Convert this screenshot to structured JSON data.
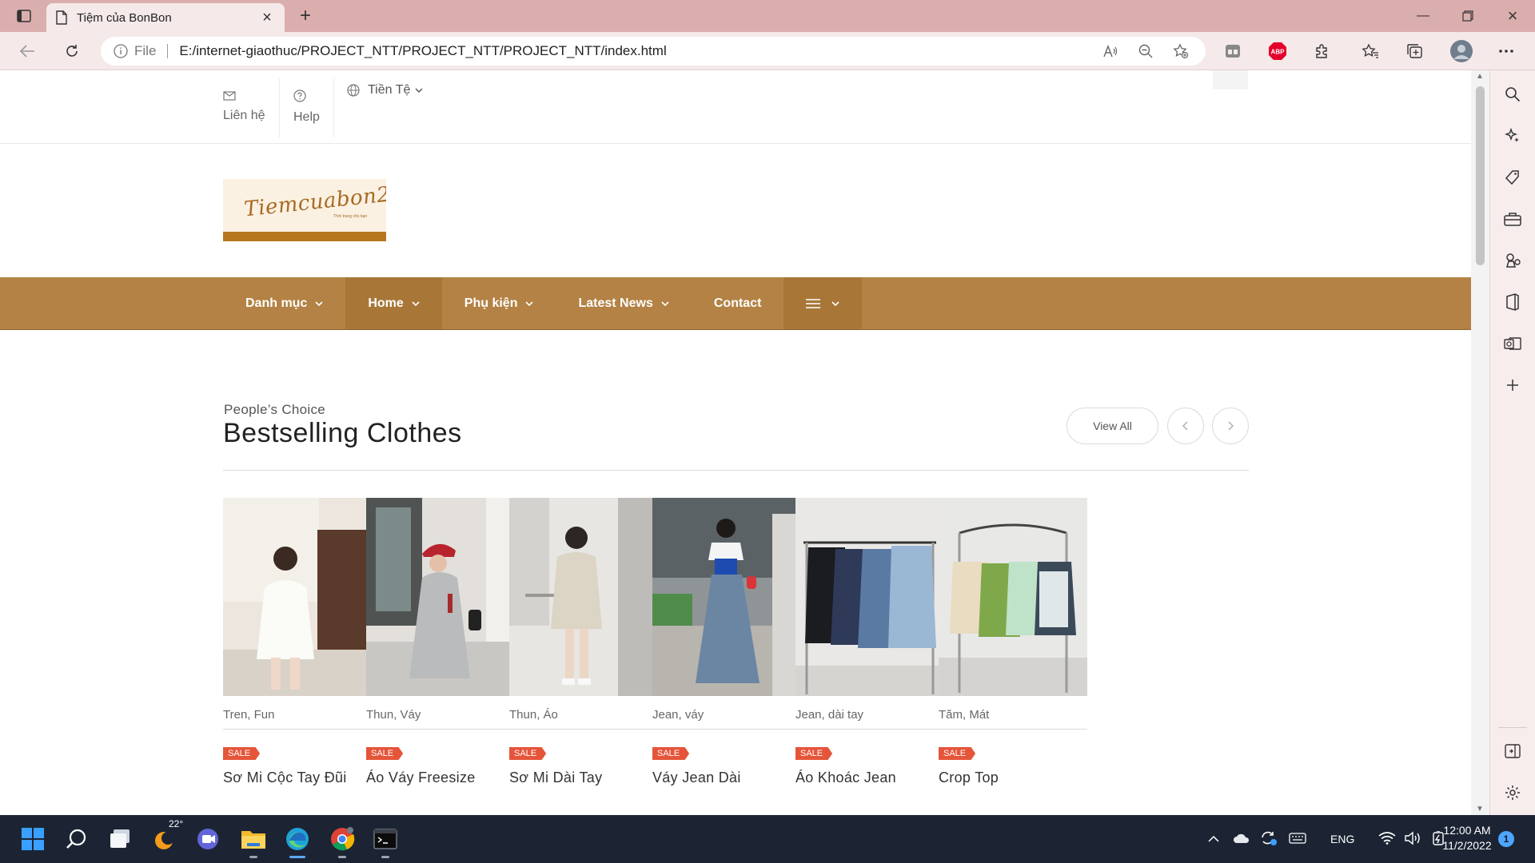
{
  "browser": {
    "tab_title": "Tiệm của BonBon",
    "address": {
      "security_label": "File",
      "url": "E:/internet-giaothuc/PROJECT_NTT/PROJECT_NTT/PROJECT_NTT/index.html"
    },
    "extension_badge": "ABP"
  },
  "topbar": {
    "contact_label": "Liên hệ",
    "help_label": "Help",
    "currency_label": "Tiền Tệ"
  },
  "brand": {
    "logo_text": "Tiemcuabon2",
    "logo_subtext": "Thời trang cho bạn"
  },
  "nav": {
    "items": [
      {
        "label": "Danh mục",
        "dropdown": true
      },
      {
        "label": "Home",
        "dropdown": true
      },
      {
        "label": "Phụ kiện",
        "dropdown": true
      },
      {
        "label": "Latest News",
        "dropdown": true
      },
      {
        "label": "Contact",
        "dropdown": false
      }
    ]
  },
  "section": {
    "kicker": "People’s Choice",
    "title": "Bestselling Clothes",
    "view_all_label": "View All"
  },
  "products": [
    {
      "category": "Tren, Fun",
      "badge": "SALE",
      "name": "Sơ Mi Cộc Tay Đũi"
    },
    {
      "category": "Thun, Váy",
      "badge": "SALE",
      "name": "Áo Váy Freesize"
    },
    {
      "category": "Thun, Áo",
      "badge": "SALE",
      "name": "Sơ Mi Dài Tay"
    },
    {
      "category": "Jean, váy",
      "badge": "SALE",
      "name": "Váy Jean Dài"
    },
    {
      "category": "Jean, dài tay",
      "badge": "SALE",
      "name": "Áo Khoác Jean"
    },
    {
      "category": "Tăm, Mát",
      "badge": "SALE",
      "name": "Crop Top"
    }
  ],
  "taskbar": {
    "weather_temp": "22°",
    "language": "ENG",
    "time": "12:00 AM",
    "date": "11/2/2022",
    "notification_count": "1"
  },
  "colors": {
    "titlebar": "#dbaeae",
    "nav_bar": "#b38244",
    "sale_badge": "#e5553a",
    "taskbar": "#1c2434"
  }
}
